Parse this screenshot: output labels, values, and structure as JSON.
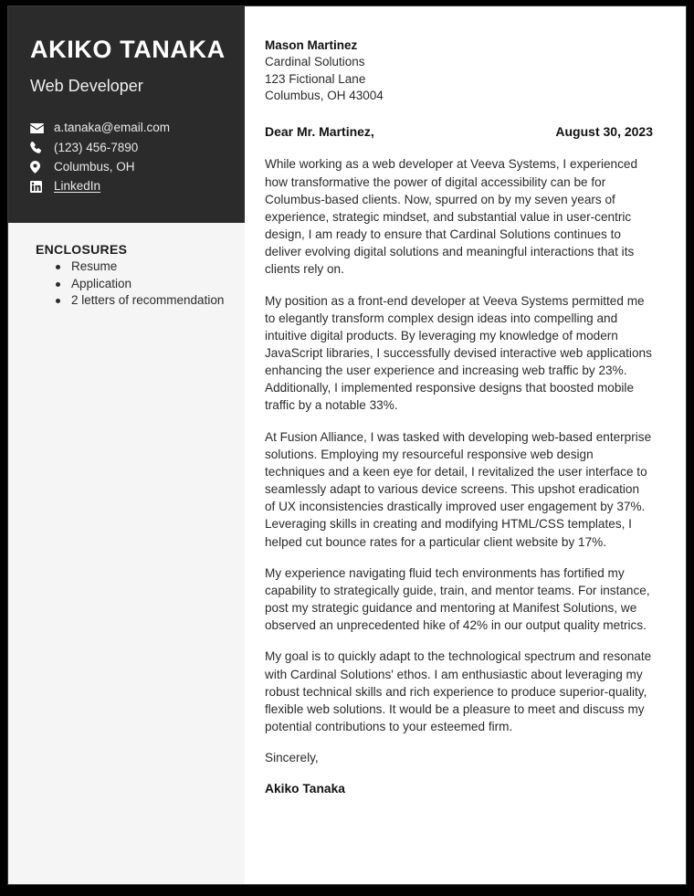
{
  "document": {
    "type": "cover-letter"
  },
  "sidebar": {
    "name": "AKIKO TANAKA",
    "job_title": "Web Developer",
    "contacts": [
      {
        "icon": "envelope-icon",
        "name": "email",
        "value": "a.tanaka@email.com",
        "link": false
      },
      {
        "icon": "phone-icon",
        "name": "phone",
        "value": "(123) 456-7890",
        "link": false
      },
      {
        "icon": "location-pin-icon",
        "name": "location",
        "value": "Columbus, OH",
        "link": false
      },
      {
        "icon": "linkedin-icon",
        "name": "linkedin",
        "value": "LinkedIn",
        "link": true
      }
    ],
    "enclosures": {
      "heading": "ENCLOSURES",
      "items": [
        "Resume",
        "Application",
        "2 letters of recommendation"
      ]
    }
  },
  "letter": {
    "recipient": {
      "name": "Mason Martinez",
      "company": "Cardinal Solutions",
      "street": "123 Fictional Lane",
      "city_state_zip": "Columbus, OH 43004"
    },
    "salutation": "Dear Mr. Martinez,",
    "date": "August 30, 2023",
    "paragraphs": [
      "While working as a web developer at Veeva Systems, I experienced how transformative the power of digital accessibility can be for Columbus-based clients. Now, spurred on by my seven years of experience, strategic mindset, and substantial value in user-centric design, I am ready to ensure that Cardinal Solutions continues to deliver evolving digital solutions and meaningful interactions that its clients rely on.",
      "My position as a front-end developer at Veeva Systems permitted me to elegantly transform complex design ideas into compelling and intuitive digital products. By leveraging my knowledge of modern JavaScript libraries, I successfully devised interactive web applications enhancing the user experience and increasing web traffic by 23%. Additionally, I implemented responsive designs that boosted mobile traffic by a notable 33%.",
      "At Fusion Alliance, I was tasked with developing web-based enterprise solutions. Employing my resourceful responsive web design techniques and a keen eye for detail, I revitalized the user interface to seamlessly adapt to various device screens. This upshot eradication of UX inconsistencies drastically improved user engagement by 37%. Leveraging skills in creating and modifying HTML/CSS templates, I helped cut bounce rates for a particular client website by 17%.",
      "My experience navigating fluid tech environments has fortified my capability to strategically guide, train, and mentor teams. For instance, post my strategic guidance and mentoring at Manifest Solutions, we observed an unprecedented hike of 42% in our output quality metrics.",
      "My goal is to quickly adapt to the technological spectrum and resonate with Cardinal Solutions' ethos. I am enthusiastic about leveraging my robust technical skills and rich experience to produce superior-quality, flexible web solutions. It would be a pleasure to meet and discuss my potential contributions to your esteemed firm."
    ],
    "closing": "Sincerely,",
    "signature": "Akiko Tanaka"
  },
  "colors": {
    "header_background": "#2b2b2b",
    "sidebar_background": "#f5f5f5",
    "page_background": "#ffffff",
    "frame": "#000000",
    "body_text": "#2a2a2a",
    "heading_text": "#111111"
  }
}
